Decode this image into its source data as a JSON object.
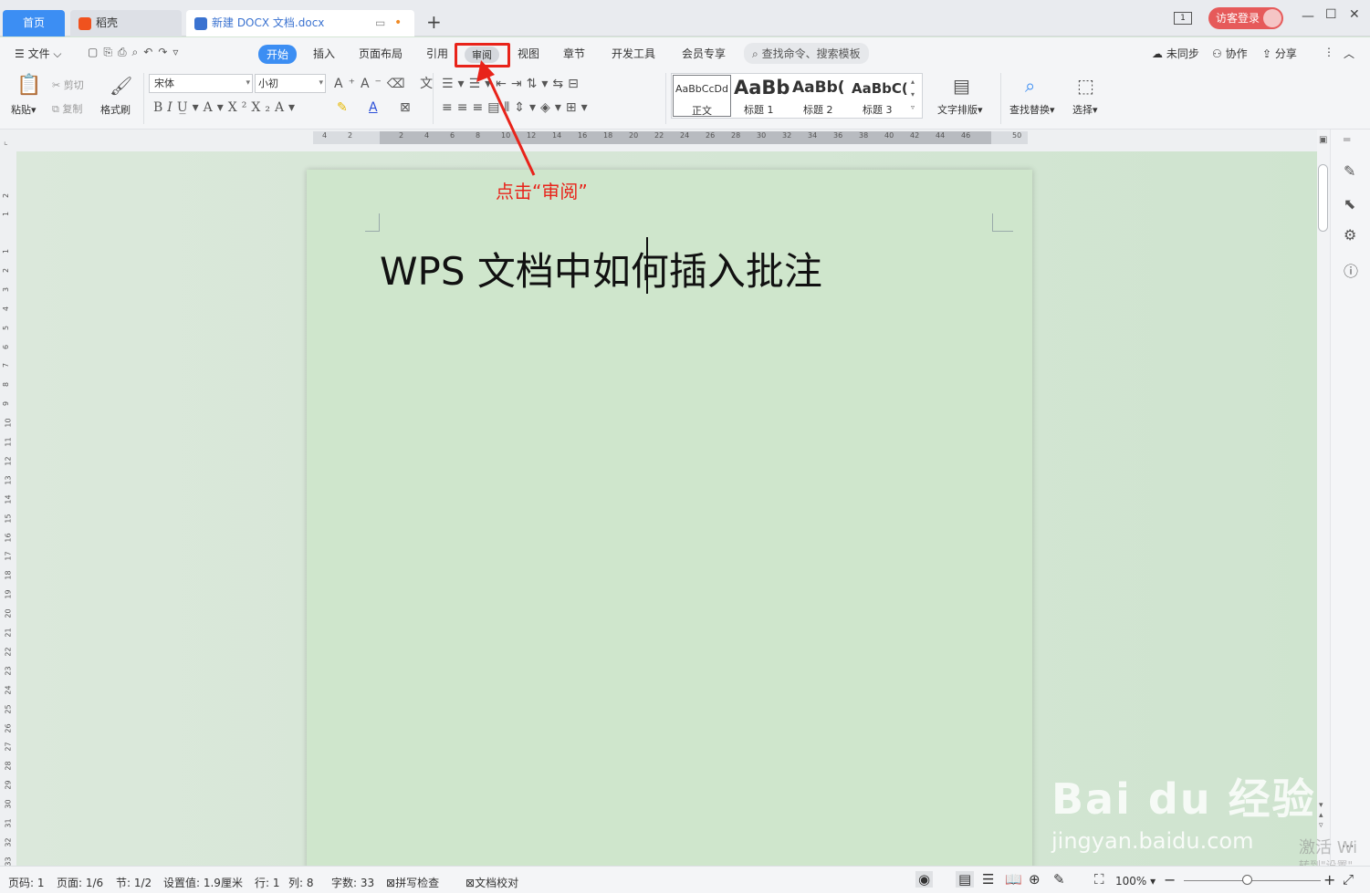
{
  "tabs": {
    "home": "首页",
    "daoke": "稻壳",
    "doc": "新建 DOCX 文档.docx",
    "add": "+",
    "page_badge": "1",
    "login": "访客登录"
  },
  "menu": {
    "file": "文件",
    "start": "开始",
    "insert": "插入",
    "layout": "页面布局",
    "ref": "引用",
    "review": "审阅",
    "view": "视图",
    "chapter": "章节",
    "dev": "开发工具",
    "member": "会员专享",
    "search": "查找命令、搜索模板",
    "sync": "未同步",
    "collab": "协作",
    "share": "分享"
  },
  "ribbon": {
    "paste": "粘贴",
    "cut": "剪切",
    "copy": "复制",
    "format_painter": "格式刷",
    "font": "宋体",
    "size": "小初",
    "styles": [
      {
        "preview": "AaBbCcDd",
        "name": "正文"
      },
      {
        "preview": "AaBb",
        "name": "标题 1"
      },
      {
        "preview": "AaBb(",
        "name": "标题 2"
      },
      {
        "preview": "AaBbC(",
        "name": "标题 3"
      }
    ],
    "text_layout": "文字排版",
    "find_replace": "查找替换",
    "select": "选择"
  },
  "ruler": {
    "h": [
      "4",
      "2",
      "2",
      "4",
      "6",
      "8",
      "10",
      "12",
      "14",
      "16",
      "18",
      "20",
      "22",
      "24",
      "26",
      "28",
      "30",
      "32",
      "34",
      "36",
      "38",
      "40",
      "42",
      "44",
      "46",
      "50"
    ],
    "v": [
      "2",
      "1",
      "1",
      "2",
      "3",
      "4",
      "5",
      "6",
      "7",
      "8",
      "9",
      "10",
      "11",
      "12",
      "13",
      "14",
      "15",
      "16",
      "17",
      "18",
      "19",
      "20",
      "21",
      "22",
      "23",
      "24",
      "25",
      "26",
      "27",
      "28",
      "29",
      "30",
      "31",
      "32",
      "33"
    ]
  },
  "document": {
    "title": "WPS 文档中如何插入批注"
  },
  "annotation": {
    "text": "点击“审阅”",
    "color": "#e8231a"
  },
  "status": {
    "page_num": "页码: 1",
    "pages": "页面: 1/6",
    "section": "节: 1/2",
    "setting": "设置值: 1.9厘米",
    "row": "行: 1",
    "col": "列: 8",
    "words": "字数: 33",
    "spell": "拼写检查",
    "proof": "文档校对",
    "zoom": "100%"
  },
  "watermark": {
    "brand": "Bai du 经验",
    "url": "jingyan.baidu.com",
    "activate": "激活 Wi",
    "goto": "转到\"设置\""
  },
  "colors": {
    "accent": "#3c8ef3",
    "login": "#e65a5a"
  }
}
